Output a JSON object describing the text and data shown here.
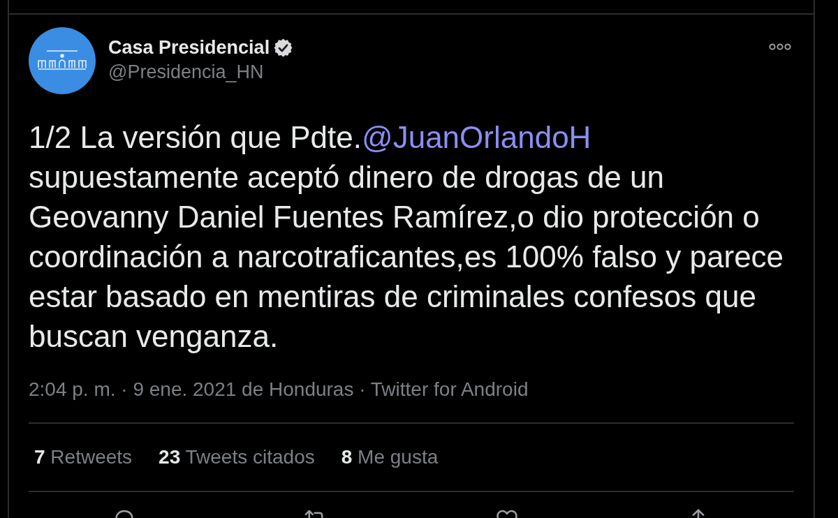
{
  "tweet": {
    "author": {
      "name": "Casa Presidencial",
      "verified": true,
      "handle": "@Presidencia_HN"
    },
    "body": [
      {
        "kind": "text",
        "text": "1/2 La versión que Pdte."
      },
      {
        "kind": "mention",
        "text": "@JuanOrlandoH"
      },
      {
        "kind": "text",
        "text": "\nsupuestamente aceptó dinero de drogas de un Geovanny Daniel Fuentes Ramírez,o dio protección o coordinación a narcotraficantes,es 100% falso y parece estar basado en mentiras de criminales confesos que buscan venganza."
      }
    ],
    "meta": "2:04 p. m. · 9 ene. 2021 de Honduras · Twitter for Android",
    "stats": [
      {
        "count": "7",
        "label": "Retweets"
      },
      {
        "count": "23",
        "label": "Tweets citados"
      },
      {
        "count": "8",
        "label": "Me gusta"
      }
    ]
  }
}
